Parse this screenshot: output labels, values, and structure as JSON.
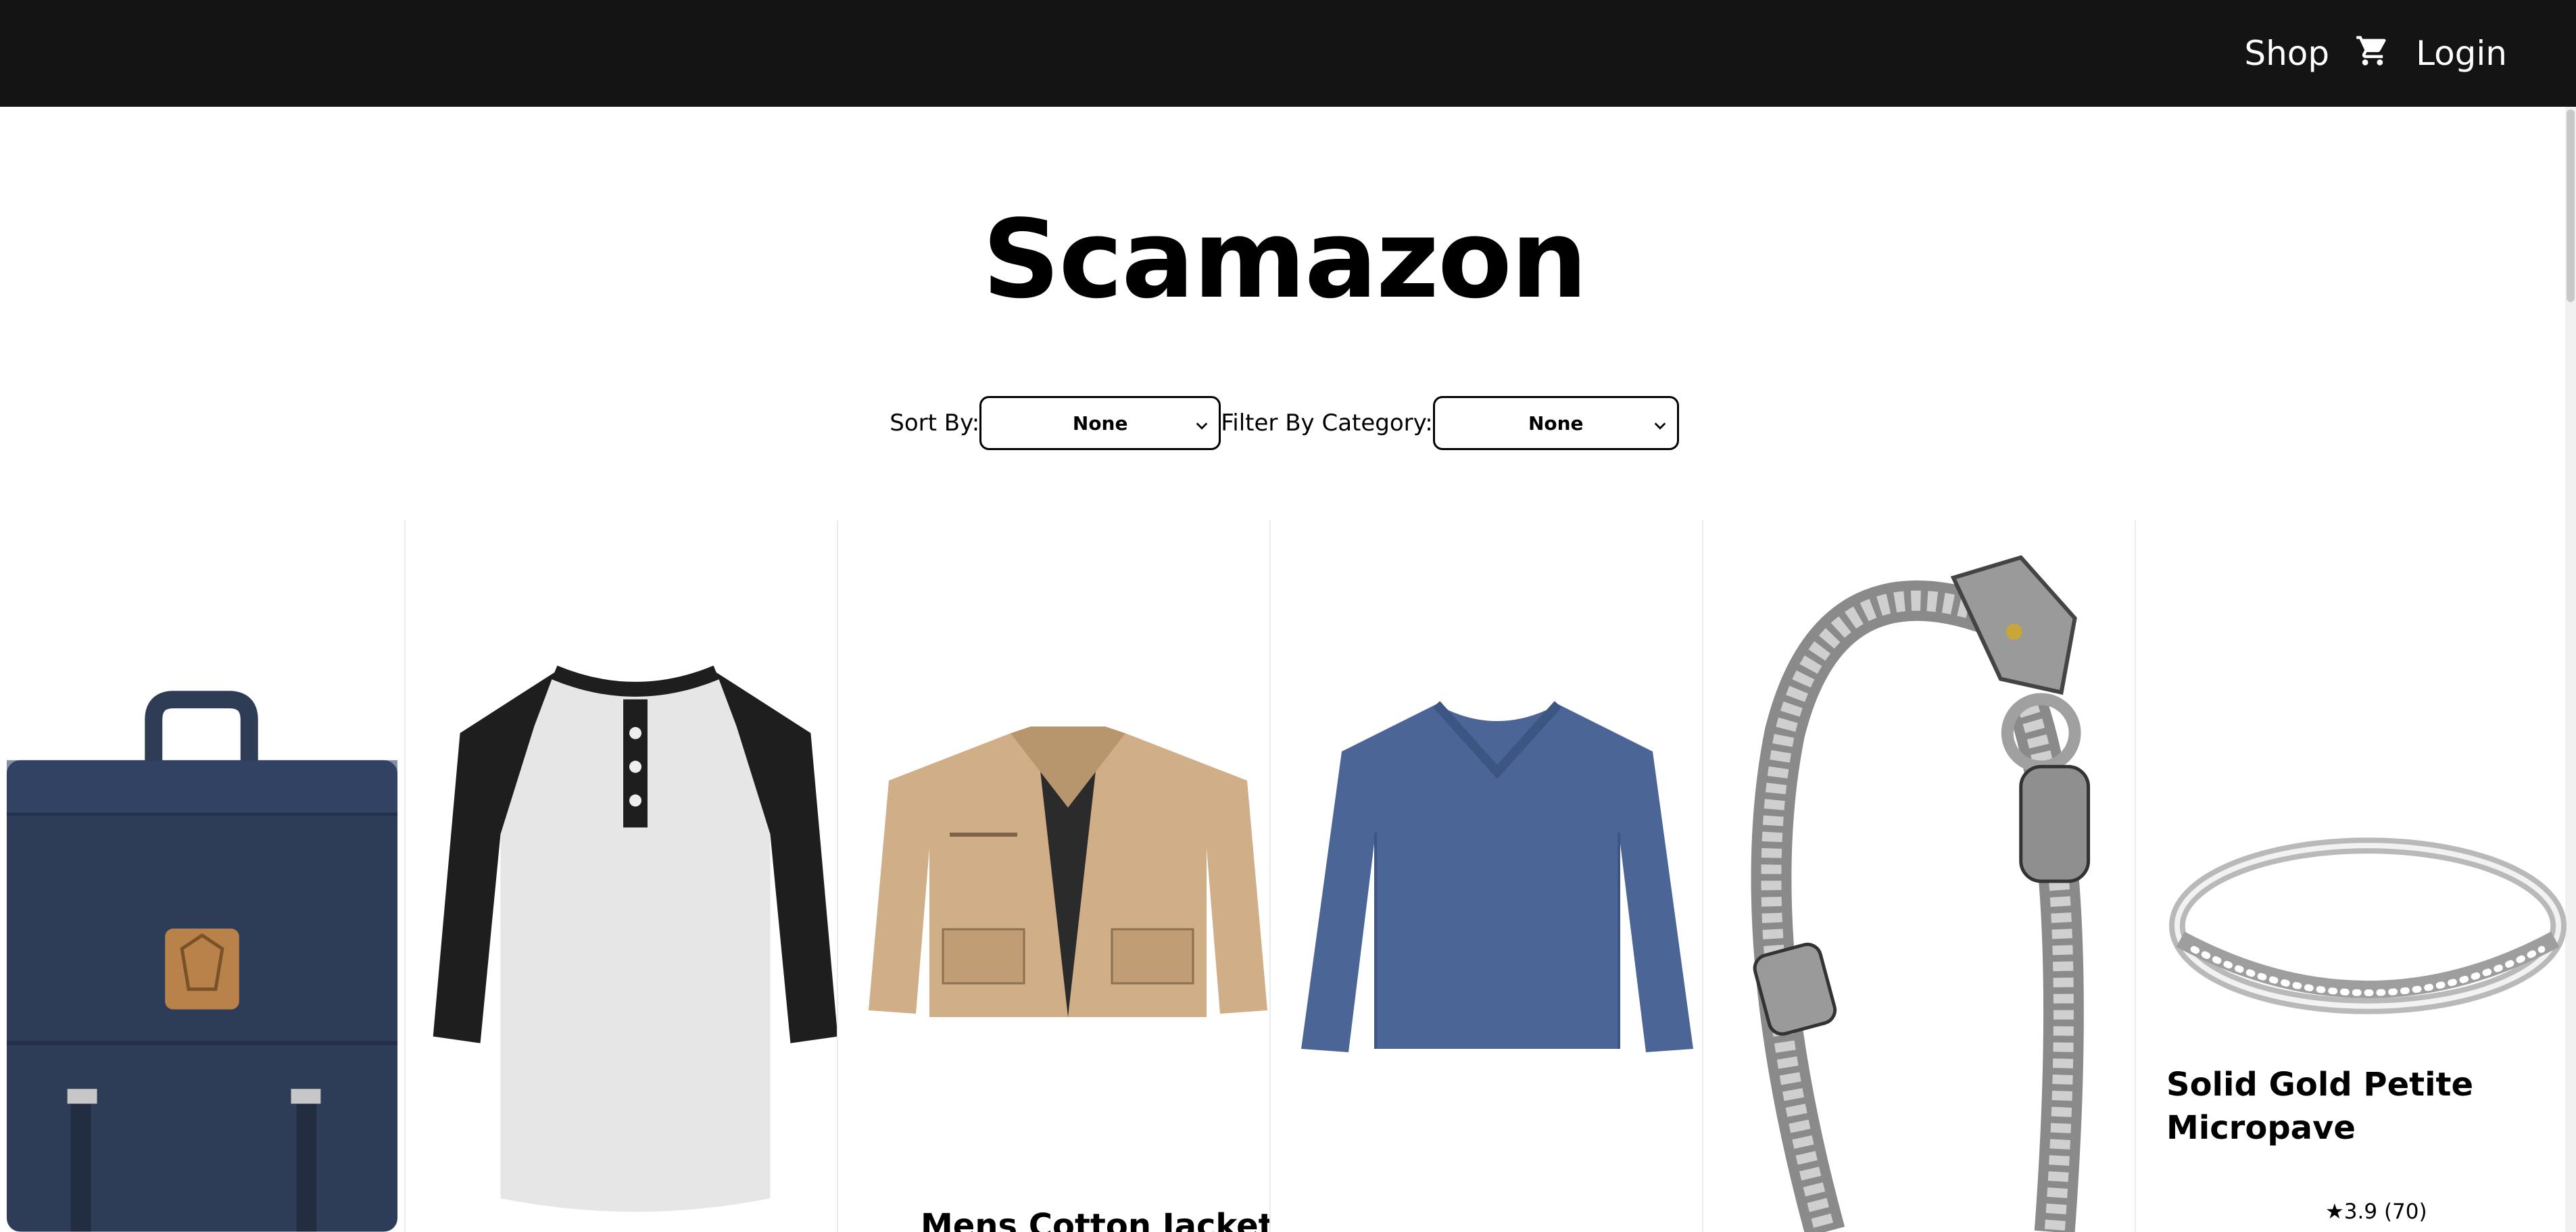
{
  "navbar": {
    "shop_label": "Shop",
    "cart_icon": "shopping-cart-icon",
    "login_label": "Login"
  },
  "page": {
    "title": "Scamazon"
  },
  "filters": {
    "sort_label": "Sort By:",
    "sort_value": "None",
    "category_label": "Filter By Category:",
    "category_value": "None"
  },
  "products": [
    {
      "image": "navy-backpack"
    },
    {
      "image": "raglan-henley-shirt"
    },
    {
      "image": "cotton-jacket",
      "name": "Mens Cotton Jacket"
    },
    {
      "image": "blue-long-sleeve-tee"
    },
    {
      "image": "dragon-chain-bracelet"
    },
    {
      "image": "micropave-ring",
      "name": "Solid Gold Petite Micropave",
      "rating_star": "★",
      "rating": "3.9 (70)"
    }
  ],
  "colors": {
    "navbar_bg": "#141414",
    "navbar_text": "#ffffff",
    "page_bg": "#ffffff"
  }
}
